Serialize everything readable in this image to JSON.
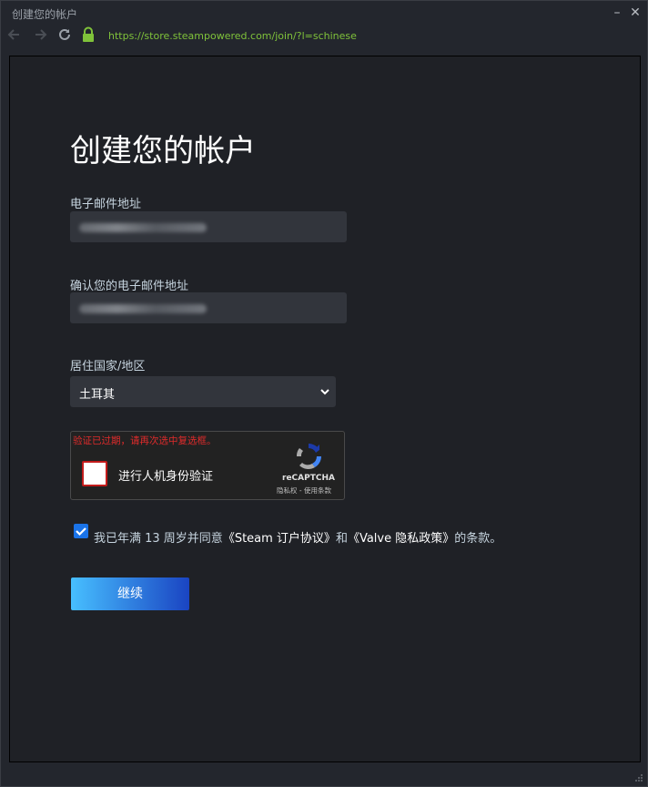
{
  "window": {
    "title": "创建您的帐户",
    "minimize": "–",
    "close": "✕"
  },
  "toolbar": {
    "url": "https://store.steampowered.com/join/?l=schinese"
  },
  "page": {
    "title": "创建您的帐户",
    "email_label": "电子邮件地址",
    "confirm_email_label": "确认您的电子邮件地址",
    "country_label": "居住国家/地区",
    "country_value": "土耳其",
    "captcha": {
      "error": "验证已过期，请再次选中复选框。",
      "label": "进行人机身份验证",
      "brand": "reCAPTCHA",
      "privacy": "隐私权",
      "sep": " - ",
      "terms": "使用条款"
    },
    "agreement": {
      "prefix": "我已年满 13 周岁并同意",
      "ssa": "《Steam 订户协议》",
      "and": "和",
      "privacy": "《Valve 隐私政策》",
      "suffix": "的条款。",
      "checked": true
    },
    "continue_label": "继续"
  },
  "colors": {
    "accent": "#1a73e8",
    "url": "#7fc23a",
    "error": "#e02b2b",
    "button_start": "#47bfff",
    "button_end": "#1a44c2"
  }
}
